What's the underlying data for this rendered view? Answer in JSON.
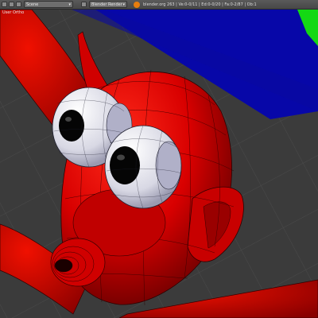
{
  "header": {
    "scene_name": "Scene",
    "render_engine": "Blender Render",
    "stats": "blender.org 263 | Ve:0-0/11 | Ed:0-0/20 | Fa:0-2/87 | Ob:1"
  },
  "viewport": {
    "label": "User Ortho"
  },
  "colors": {
    "background": "#3b3b3b",
    "header": "#4f4f4f",
    "mesh": "#d80000",
    "wire": "#300000",
    "eye_white": "#e6e6ec",
    "pupil": "#050505",
    "axis_blue": "#0707a8",
    "axis_green": "#14d814"
  },
  "icons": [
    "editor-type-icon",
    "screen-layout-icon",
    "scene-icon",
    "render-engine-icon",
    "blender-logo-icon"
  ]
}
